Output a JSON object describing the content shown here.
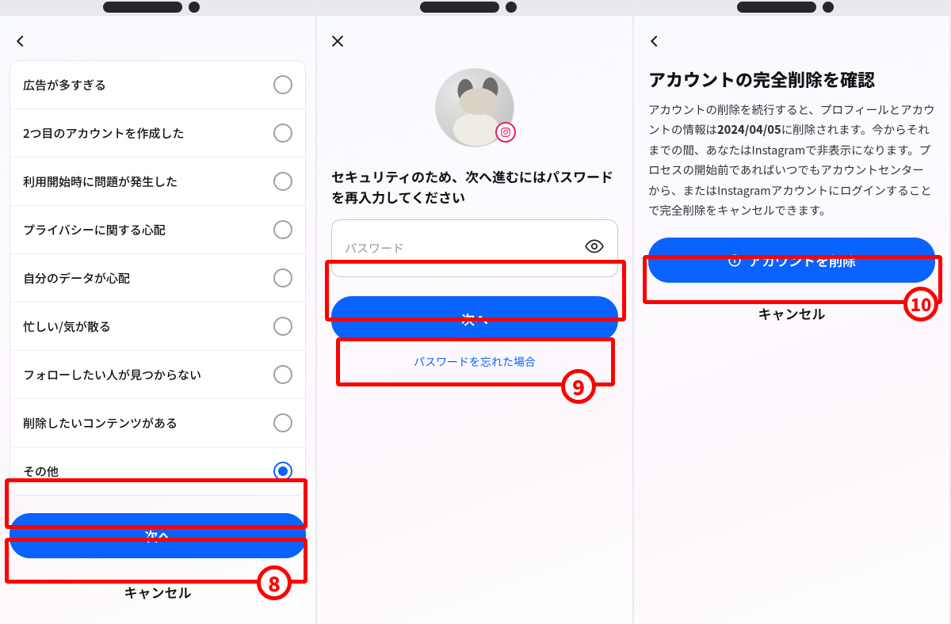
{
  "panel1": {
    "reasons": [
      {
        "label": "広告が多すぎる",
        "selected": false
      },
      {
        "label": "2つ目のアカウントを作成した",
        "selected": false
      },
      {
        "label": "利用開始時に問題が発生した",
        "selected": false
      },
      {
        "label": "プライバシーに関する心配",
        "selected": false
      },
      {
        "label": "自分のデータが心配",
        "selected": false
      },
      {
        "label": "忙しい/気が散る",
        "selected": false
      },
      {
        "label": "フォローしたい人が見つからない",
        "selected": false
      },
      {
        "label": "削除したいコンテンツがある",
        "selected": false
      },
      {
        "label": "その他",
        "selected": true
      }
    ],
    "next_label": "次へ",
    "cancel_label": "キャンセル",
    "badge": "8"
  },
  "panel2": {
    "message": "セキュリティのため、次へ進むにはパスワードを再入力してください",
    "password_placeholder": "パスワード",
    "next_label": "次へ",
    "forgot_label": "パスワードを忘れた場合",
    "badge": "9"
  },
  "panel3": {
    "title": "アカウントの完全削除を確認",
    "body_pre": "アカウントの削除を続行すると、プロフィールとアカウントの情報は",
    "body_date": "2024/04/05",
    "body_post": "に削除されます。今からそれまでの間、あなたはInstagramで非表示になります。プロセスの開始前であればいつでもアカウントセンターから、またはInstagramアカウントにログインすることで完全削除をキャンセルできます。",
    "delete_label": "アカウントを削除",
    "cancel_label": "キャンセル",
    "badge": "10"
  }
}
